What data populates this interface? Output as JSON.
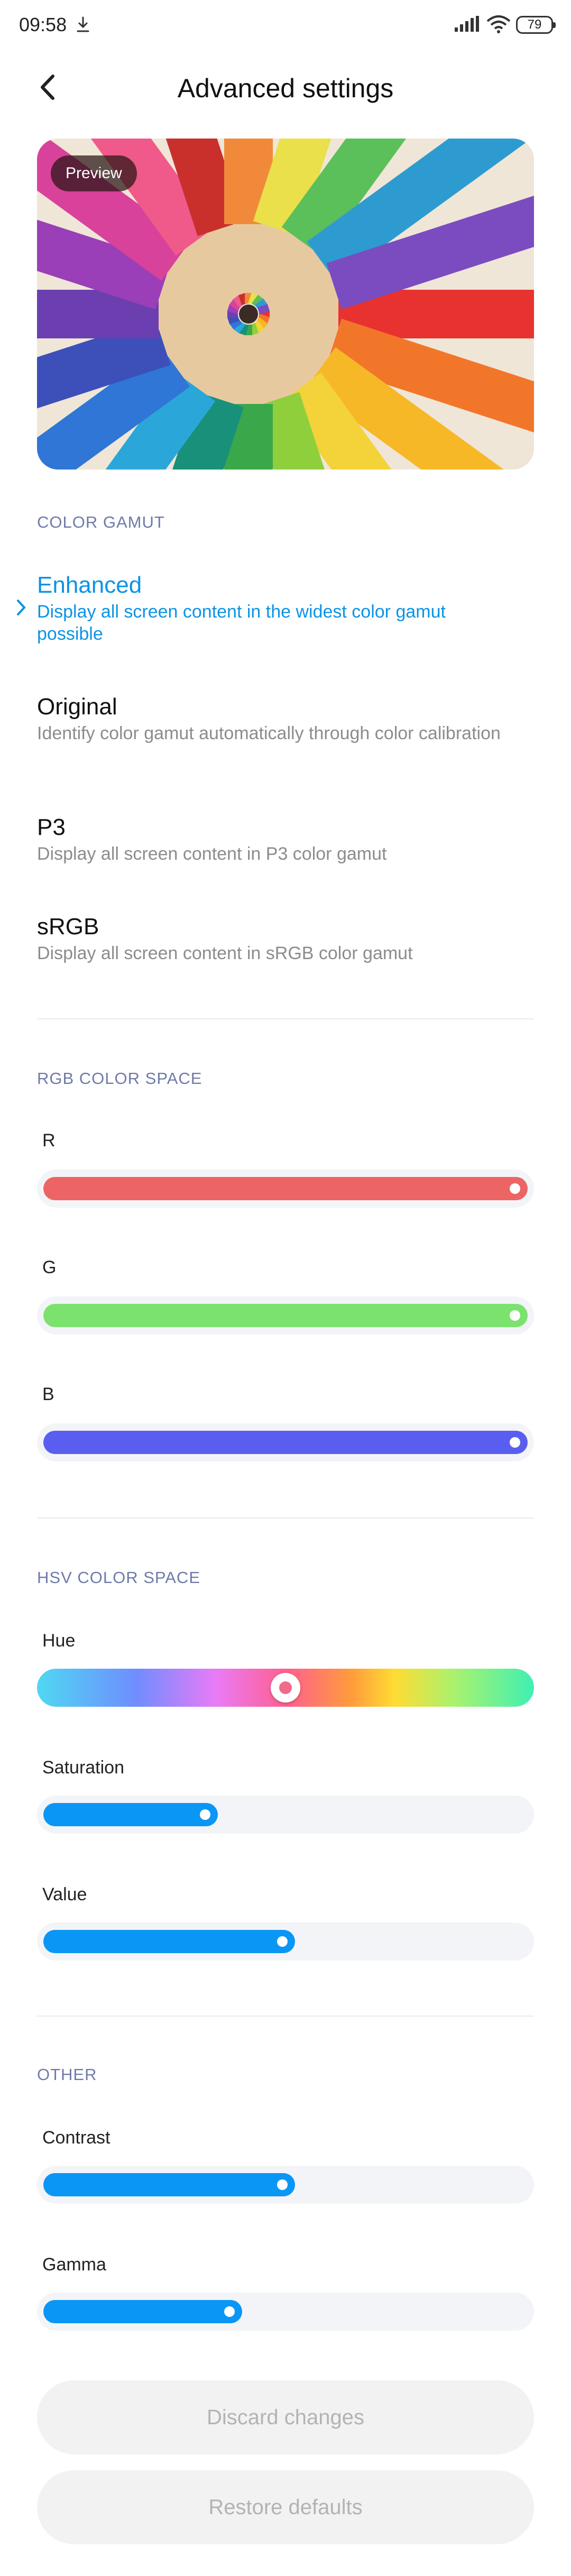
{
  "status_bar": {
    "time": "09:58",
    "battery": "79",
    "download_icon": "download-icon",
    "signal_icon": "signal-icon",
    "wifi_icon": "wifi-icon"
  },
  "header": {
    "title": "Advanced settings",
    "back_icon": "chevron-left-icon"
  },
  "preview": {
    "badge": "Preview"
  },
  "color_gamut": {
    "section_title": "COLOR GAMUT",
    "selected": "Enhanced",
    "accent_color": "#0c93e6",
    "options": [
      {
        "name": "Enhanced",
        "description": "Display all screen content in the widest color gamut possible"
      },
      {
        "name": "Original",
        "description": "Identify color gamut automatically through color calibration"
      },
      {
        "name": "P3",
        "description": "Display all screen content in P3 color gamut"
      },
      {
        "name": "sRGB",
        "description": "Display all screen content in sRGB color gamut"
      }
    ]
  },
  "rgb": {
    "section_title": "RGB COLOR SPACE",
    "sliders": [
      {
        "label": "R",
        "value": 1.0,
        "color": "#ec6464"
      },
      {
        "label": "G",
        "value": 1.0,
        "color": "#7ce26e"
      },
      {
        "label": "B",
        "value": 1.0,
        "color": "#5a5ef0"
      }
    ]
  },
  "hsv": {
    "section_title": "HSV COLOR SPACE",
    "hue": {
      "label": "Hue",
      "value": 0.5
    },
    "sliders": [
      {
        "label": "Saturation",
        "value": 0.36,
        "color": "#0a96f5"
      },
      {
        "label": "Value",
        "value": 0.52,
        "color": "#0a96f5"
      }
    ]
  },
  "other": {
    "section_title": "OTHER",
    "sliders": [
      {
        "label": "Contrast",
        "value": 0.52,
        "color": "#0a96f5"
      },
      {
        "label": "Gamma",
        "value": 0.41,
        "color": "#0a96f5"
      }
    ]
  },
  "buttons": {
    "discard": "Discard changes",
    "restore": "Restore defaults"
  }
}
